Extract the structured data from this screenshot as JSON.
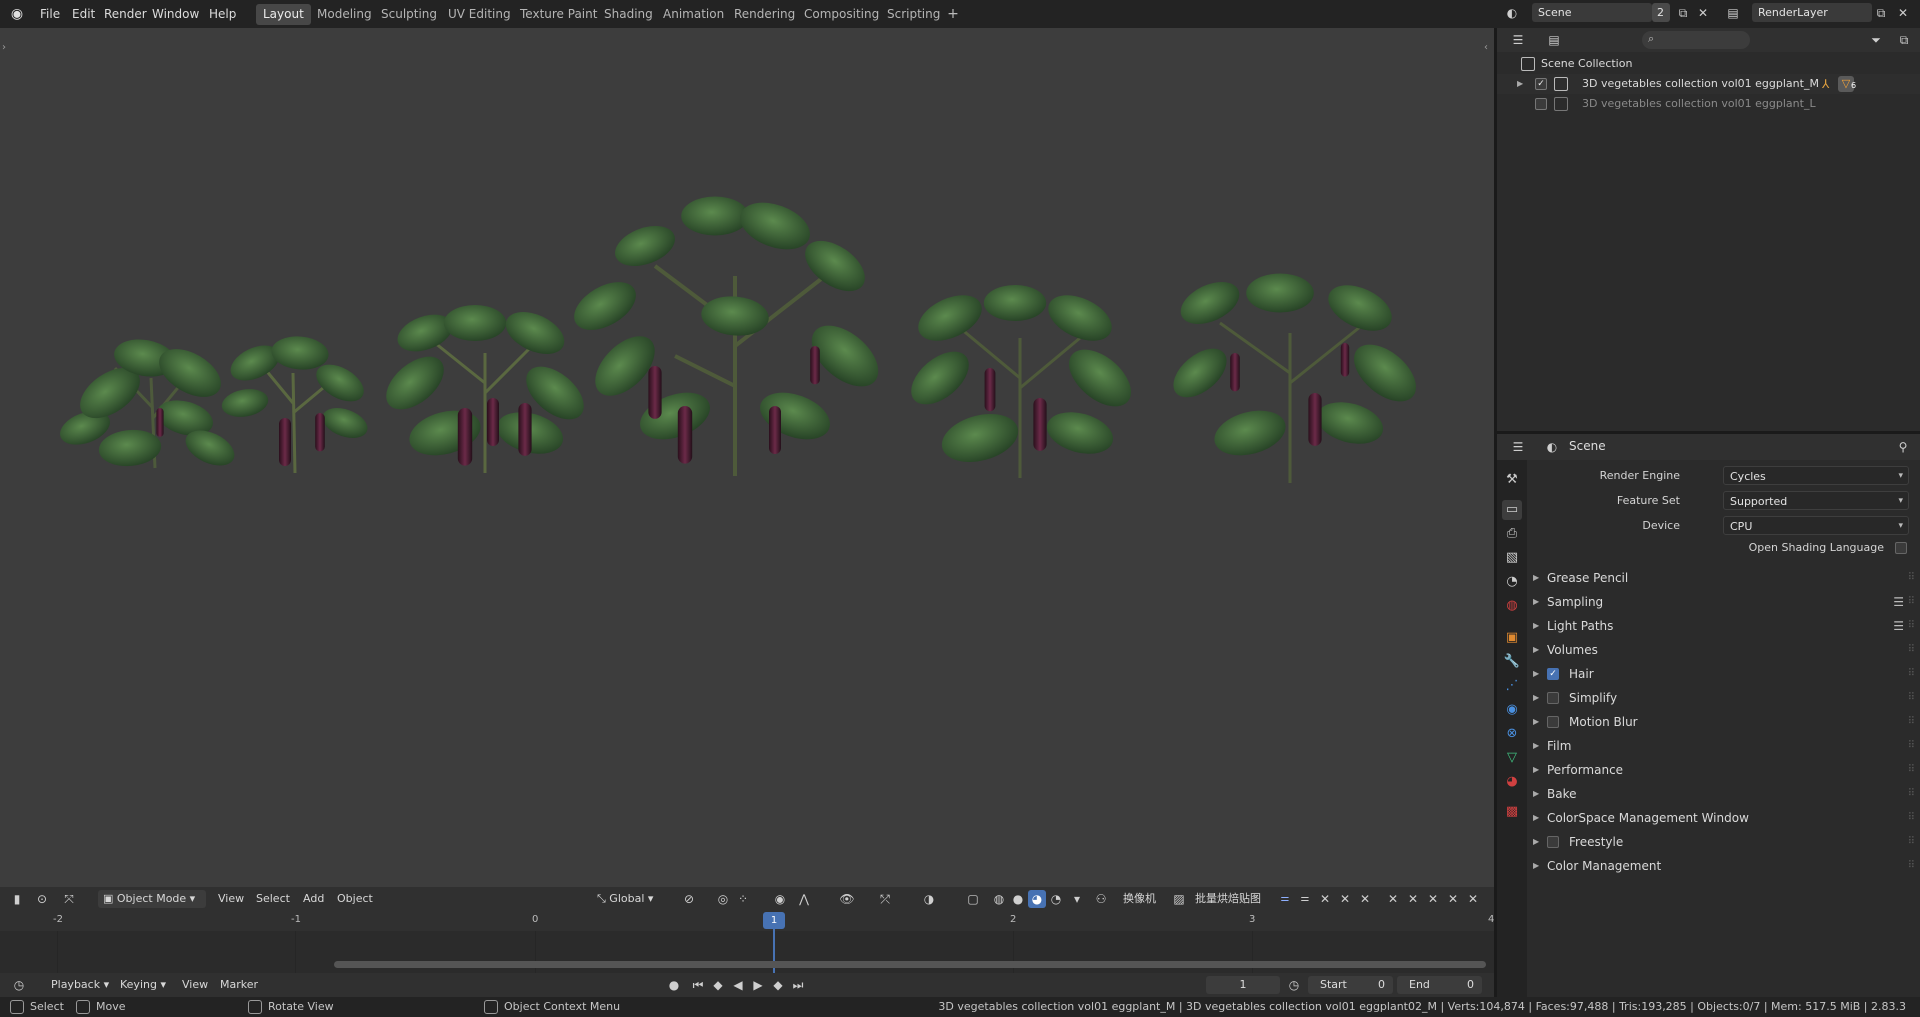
{
  "topbar": {
    "menus": [
      "File",
      "Edit",
      "Render",
      "Window",
      "Help"
    ],
    "workspaces": [
      "Layout",
      "Modeling",
      "Sculpting",
      "UV Editing",
      "Texture Paint",
      "Shading",
      "Animation",
      "Rendering",
      "Compositing",
      "Scripting"
    ],
    "active_workspace": "Layout",
    "scene_name": "Scene",
    "scene_users": "2",
    "view_layer": "RenderLayer"
  },
  "viewport_header": {
    "mode": "Object Mode",
    "view": "View",
    "select": "Select",
    "add": "Add",
    "object": "Object",
    "orientation": "Global",
    "camera_label": "换像机",
    "bake_label": "批量烘焙贴图"
  },
  "timeline": {
    "ticks": [
      "-2",
      "-1",
      "0",
      "1",
      "2",
      "3",
      "4"
    ],
    "current_frame": "1",
    "menus": [
      "Playback",
      "Keying",
      "View",
      "Marker"
    ],
    "frame_field": "1",
    "start_label": "Start",
    "start_value": "0",
    "end_label": "End",
    "end_value": "0"
  },
  "statusbar": {
    "select": "Select",
    "move": "Move",
    "rotate": "Rotate View",
    "context": "Object Context Menu",
    "info": "3D vegetables collection vol01 eggplant_M | 3D vegetables collection vol01 eggplant02_M | Verts:104,874 | Faces:97,488 | Tris:193,285 | Objects:0/7 | Mem: 517.5 MiB | 2.83.3"
  },
  "outliner": {
    "root": "Scene Collection",
    "items": [
      {
        "name": "3D vegetables collection vol01 eggplant_M",
        "checked": true,
        "badge": "6"
      },
      {
        "name": "3D vegetables collection vol01 eggplant_L",
        "checked": false
      }
    ]
  },
  "properties": {
    "context": "Scene",
    "render_engine_label": "Render Engine",
    "render_engine": "Cycles",
    "feature_set_label": "Feature Set",
    "feature_set": "Supported",
    "device_label": "Device",
    "device": "CPU",
    "osl_label": "Open Shading Language",
    "panels": [
      {
        "label": "Grease Pencil"
      },
      {
        "label": "Sampling"
      },
      {
        "label": "Light Paths"
      },
      {
        "label": "Volumes"
      },
      {
        "label": "Hair"
      },
      {
        "label": "Simplify"
      },
      {
        "label": "Motion Blur"
      },
      {
        "label": "Film"
      },
      {
        "label": "Performance"
      },
      {
        "label": "Bake"
      },
      {
        "label": "ColorSpace Management Window"
      },
      {
        "label": "Freestyle"
      },
      {
        "label": "Color Management"
      }
    ]
  },
  "colors": {
    "accent": "#4772b3",
    "viewport_bg": "#3d3d3d",
    "leaf_dark": "#2c4a2c",
    "leaf_light": "#4d7a45",
    "eggplant": "#3a1526"
  }
}
